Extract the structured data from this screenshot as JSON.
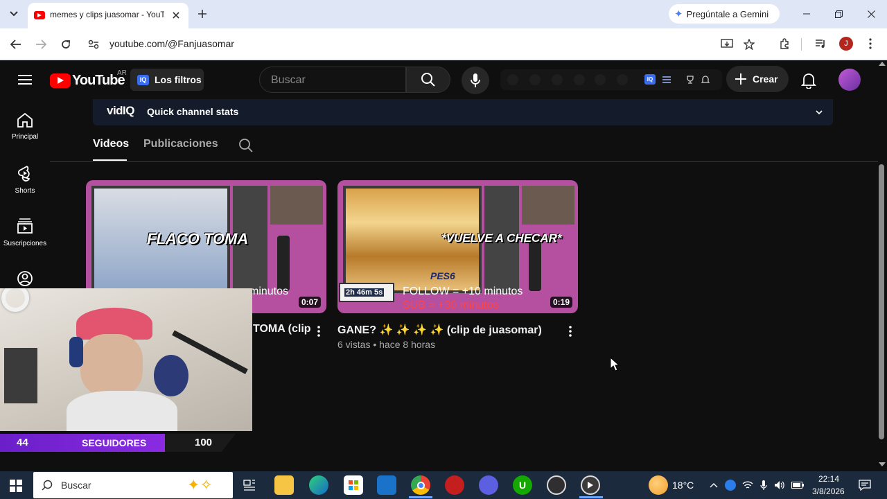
{
  "browser": {
    "tab_title": "memes y clips juasomar - YouTube",
    "gemini_label": "Pregúntale a Gemini",
    "url": "youtube.com/@Fanjuasomar",
    "profile_initial": "J"
  },
  "youtube": {
    "country_code": "AR",
    "logo_text": "YouTube",
    "filters_label": "Los filtros",
    "search_placeholder": "Buscar",
    "create_label": "Crear",
    "vidiq_brand": "vidIQ",
    "vidiq_stats_label": "Quick channel stats",
    "sidebar": [
      {
        "label": "Principal",
        "icon": "home-icon"
      },
      {
        "label": "Shorts",
        "icon": "shorts-icon"
      },
      {
        "label": "Suscripciones",
        "icon": "subscriptions-icon"
      },
      {
        "label": "",
        "icon": "account-icon"
      }
    ],
    "channel_tabs": [
      {
        "label": "Videos",
        "active": true
      },
      {
        "label": "Publicaciones",
        "active": false
      }
    ],
    "videos": [
      {
        "title": "FLACO TOMA (clip de juasomar)",
        "visible_title": "TOMA (clip",
        "duration": "0:07",
        "thumb_caption": "FLACO TOMA",
        "thumb_overlay": "minutos",
        "meta": ""
      },
      {
        "title": "GANE? ✨ ✨ ✨ ✨ (clip de juasomar)",
        "duration": "0:19",
        "thumb_caption": "*VUELVE A CHECAR*",
        "thumb_overlay_1": "FOLLOW = +10 minutos",
        "thumb_overlay_2": "SUB = +30 minutos",
        "thumb_timer": "2h 46m 5s",
        "thumb_game": "PES6",
        "meta": "6 vistas • hace 8 horas"
      }
    ]
  },
  "webcam_overlay": {
    "followers_current": "44",
    "followers_label": "SEGUIDORES",
    "followers_goal": "100"
  },
  "taskbar": {
    "search_placeholder": "Buscar",
    "weather": "18°C",
    "time": "22:14",
    "date": "3/8/2026"
  },
  "colors": {
    "yt_bg": "#0f0f0f",
    "yt_red": "#ff0000",
    "chrome_tabbar": "#dfe6f5",
    "taskbar": "#1c2a3e",
    "goal_purple": "#8a2be2"
  }
}
